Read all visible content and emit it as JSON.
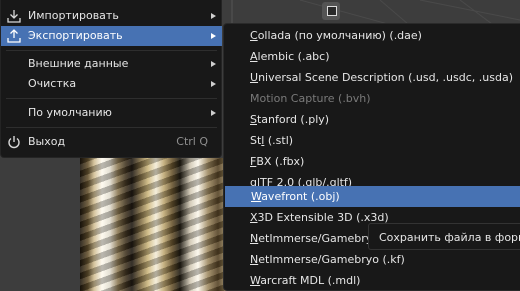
{
  "file_menu": {
    "items": [
      {
        "label": "Импортировать",
        "icon": "import-icon"
      },
      {
        "label": "Экспортировать",
        "icon": "export-icon"
      },
      {
        "label": "Внешние данные"
      },
      {
        "label": "Очистка"
      },
      {
        "label": "По умолчанию"
      },
      {
        "label": "Выход",
        "icon": "power-icon",
        "shortcut": "Ctrl Q"
      }
    ]
  },
  "export_menu": {
    "items": [
      {
        "label": "Collada (по умолчанию) (.dae)",
        "ul": "C",
        "rest": "ollada (по умолчанию) (.dae)"
      },
      {
        "label": "Alembic (.abc)",
        "ul": "A",
        "rest": "lembic (.abc)"
      },
      {
        "label": "Universal Scene Description (.usd, .usdc, .usda)",
        "ul": "U",
        "rest": "niversal Scene Description (.usd, .usdc, .usda)"
      },
      {
        "label": "Motion Capture (.bvh)",
        "ul": "",
        "rest": "Motion Capture (.bvh)",
        "disabled": true
      },
      {
        "label": "Stanford (.ply)",
        "ul": "S",
        "rest": "tanford (.ply)"
      },
      {
        "label": "Stl (.stl)",
        "pre": "St",
        "ul": "l",
        "rest": " (.stl)"
      },
      {
        "label": "FBX (.fbx)",
        "ul": "F",
        "rest": "BX (.fbx)"
      },
      {
        "label": "glTF 2.0 (.glb/.gltf)",
        "ul": "g",
        "rest": "lTF 2.0 (.glb/.gltf)"
      },
      {
        "label": "Wavefront (.obj)",
        "ul": "W",
        "rest": "avefront (.obj)"
      },
      {
        "label": "X3D Extensible 3D (.x3d)",
        "ul": "X",
        "rest": "3D Extensible 3D (.x3d)"
      },
      {
        "label": "NetImmerse/Gamebryo",
        "ul": "N",
        "rest": "etImmerse/Gamebryo"
      },
      {
        "label": "NetImmerse/Gamebryo (.kf)",
        "ul": "N",
        "rest": "etImmerse/Gamebryo (.kf)"
      },
      {
        "label": "Warcraft MDL (.mdl)",
        "ul": "W",
        "rest": "arcraft MDL (.mdl)"
      }
    ]
  },
  "tooltip": {
    "text": "Сохранить файла в форма"
  },
  "colors": {
    "menu_bg": "#181818",
    "highlight": "#4772b3",
    "text": "#e6e6e6",
    "disabled_text": "#7a7a7a"
  }
}
